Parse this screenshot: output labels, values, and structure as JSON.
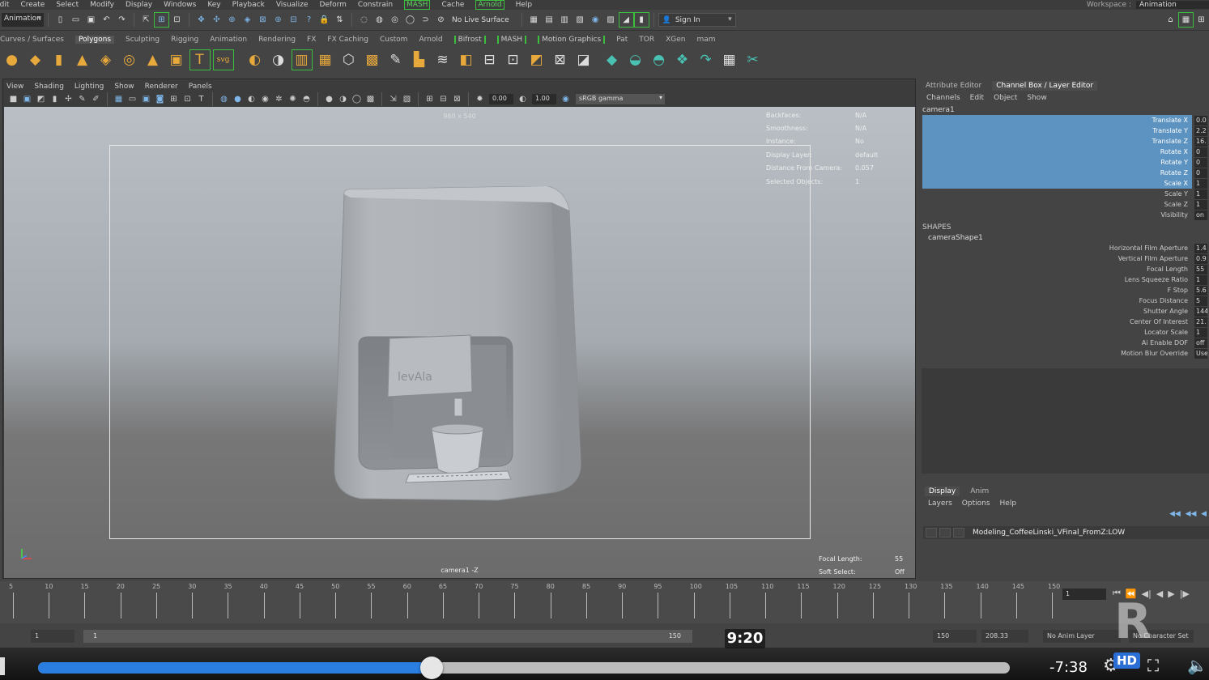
{
  "menubar": {
    "items": [
      "Edit",
      "Create",
      "Select",
      "Modify",
      "Display",
      "Windows",
      "Key",
      "Playback",
      "Visualize",
      "Deform",
      "Constrain",
      "MASH",
      "Cache",
      "Arnold",
      "Help"
    ],
    "highlighted": [
      "MASH",
      "Arnold"
    ],
    "workspace_label": "Workspace :",
    "workspace_value": "Animation"
  },
  "statusline": {
    "mode": "Animation",
    "live_surface": "No Live Surface",
    "sign_in": "Sign In"
  },
  "shelf_tabs": {
    "tabs": [
      "Curves / Surfaces",
      "Polygons",
      "Sculpting",
      "Rigging",
      "Animation",
      "Rendering",
      "FX",
      "FX Caching",
      "Custom",
      "Arnold",
      "Bifrost",
      "MASH",
      "Motion Graphics",
      "Pat",
      "TOR",
      "XGen",
      "mam"
    ],
    "active": "Polygons"
  },
  "viewport_panel": {
    "menu": [
      "View",
      "Shading",
      "Lighting",
      "Show",
      "Renderer",
      "Panels"
    ],
    "exposure": "0.00",
    "gamma": "1.00",
    "color_space": "sRGB gamma",
    "resolution_label": "960 x 540",
    "camera_label": "camera1 -Z",
    "hud": [
      {
        "k": "Backfaces:",
        "v": "N/A"
      },
      {
        "k": "Smoothness:",
        "v": "N/A"
      },
      {
        "k": "Instance:",
        "v": "No"
      },
      {
        "k": "Display Layer:",
        "v": "default"
      },
      {
        "k": "Distance From Camera:",
        "v": "0.057"
      },
      {
        "k": "Selected Objects:",
        "v": "1"
      }
    ],
    "hud_bottom": [
      {
        "k": "Focal Length:",
        "v": "55"
      },
      {
        "k": "Soft Select:",
        "v": "Off"
      }
    ],
    "model_logo_text": "levAla"
  },
  "channel_box": {
    "tabs": [
      "Attribute Editor",
      "Channel Box / Layer Editor"
    ],
    "active_tab": "Channel Box / Layer Editor",
    "menu": [
      "Channels",
      "Edit",
      "Object",
      "Show"
    ],
    "object": "camera1",
    "attributes": [
      {
        "name": "Translate X",
        "value": "0.0",
        "selected": true
      },
      {
        "name": "Translate Y",
        "value": "2.2",
        "selected": true
      },
      {
        "name": "Translate Z",
        "value": "16.",
        "selected": true
      },
      {
        "name": "Rotate X",
        "value": "0",
        "selected": true
      },
      {
        "name": "Rotate Y",
        "value": "0",
        "selected": true
      },
      {
        "name": "Rotate Z",
        "value": "0",
        "selected": true
      },
      {
        "name": "Scale X",
        "value": "1",
        "selected": true
      },
      {
        "name": "Scale Y",
        "value": "1",
        "selected": false
      },
      {
        "name": "Scale Z",
        "value": "1",
        "selected": false
      },
      {
        "name": "Visibility",
        "value": "on",
        "selected": false
      }
    ],
    "shapes_heading": "SHAPES",
    "shape_name": "cameraShape1",
    "shape_attributes": [
      {
        "name": "Horizontal Film Aperture",
        "value": "1.4"
      },
      {
        "name": "Vertical Film Aperture",
        "value": "0.9"
      },
      {
        "name": "Focal Length",
        "value": "55"
      },
      {
        "name": "Lens Squeeze Ratio",
        "value": "1"
      },
      {
        "name": "F Stop",
        "value": "5.6"
      },
      {
        "name": "Focus Distance",
        "value": "5"
      },
      {
        "name": "Shutter Angle",
        "value": "144"
      },
      {
        "name": "Center Of Interest",
        "value": "21."
      },
      {
        "name": "Locator Scale",
        "value": "1"
      },
      {
        "name": "Ai Enable DOF",
        "value": "off"
      },
      {
        "name": "Motion Blur Override",
        "value": "Use"
      }
    ]
  },
  "layer_editor": {
    "tabs": [
      "Display",
      "Anim"
    ],
    "active_tab": "Display",
    "menu": [
      "Layers",
      "Options",
      "Help"
    ],
    "layer_name": "Modeling_CoffeeLinski_VFinal_FromZ:LOW"
  },
  "timeline": {
    "ticks": [
      5,
      10,
      15,
      20,
      25,
      30,
      35,
      40,
      45,
      50,
      55,
      60,
      65,
      70,
      75,
      80,
      85,
      90,
      95,
      100,
      105,
      110,
      115,
      120,
      125,
      130,
      135,
      140,
      145,
      150
    ],
    "current_frame": "1"
  },
  "range": {
    "start": "1",
    "bar_start": "1",
    "bar_end": "150",
    "end": "150",
    "end_total": "208.33",
    "anim_layer": "No Anim Layer",
    "character_set": "No Character Set"
  },
  "video": {
    "current_time": "9:20",
    "remaining": "-7:38",
    "quality": "HD",
    "progress": 0.405
  }
}
